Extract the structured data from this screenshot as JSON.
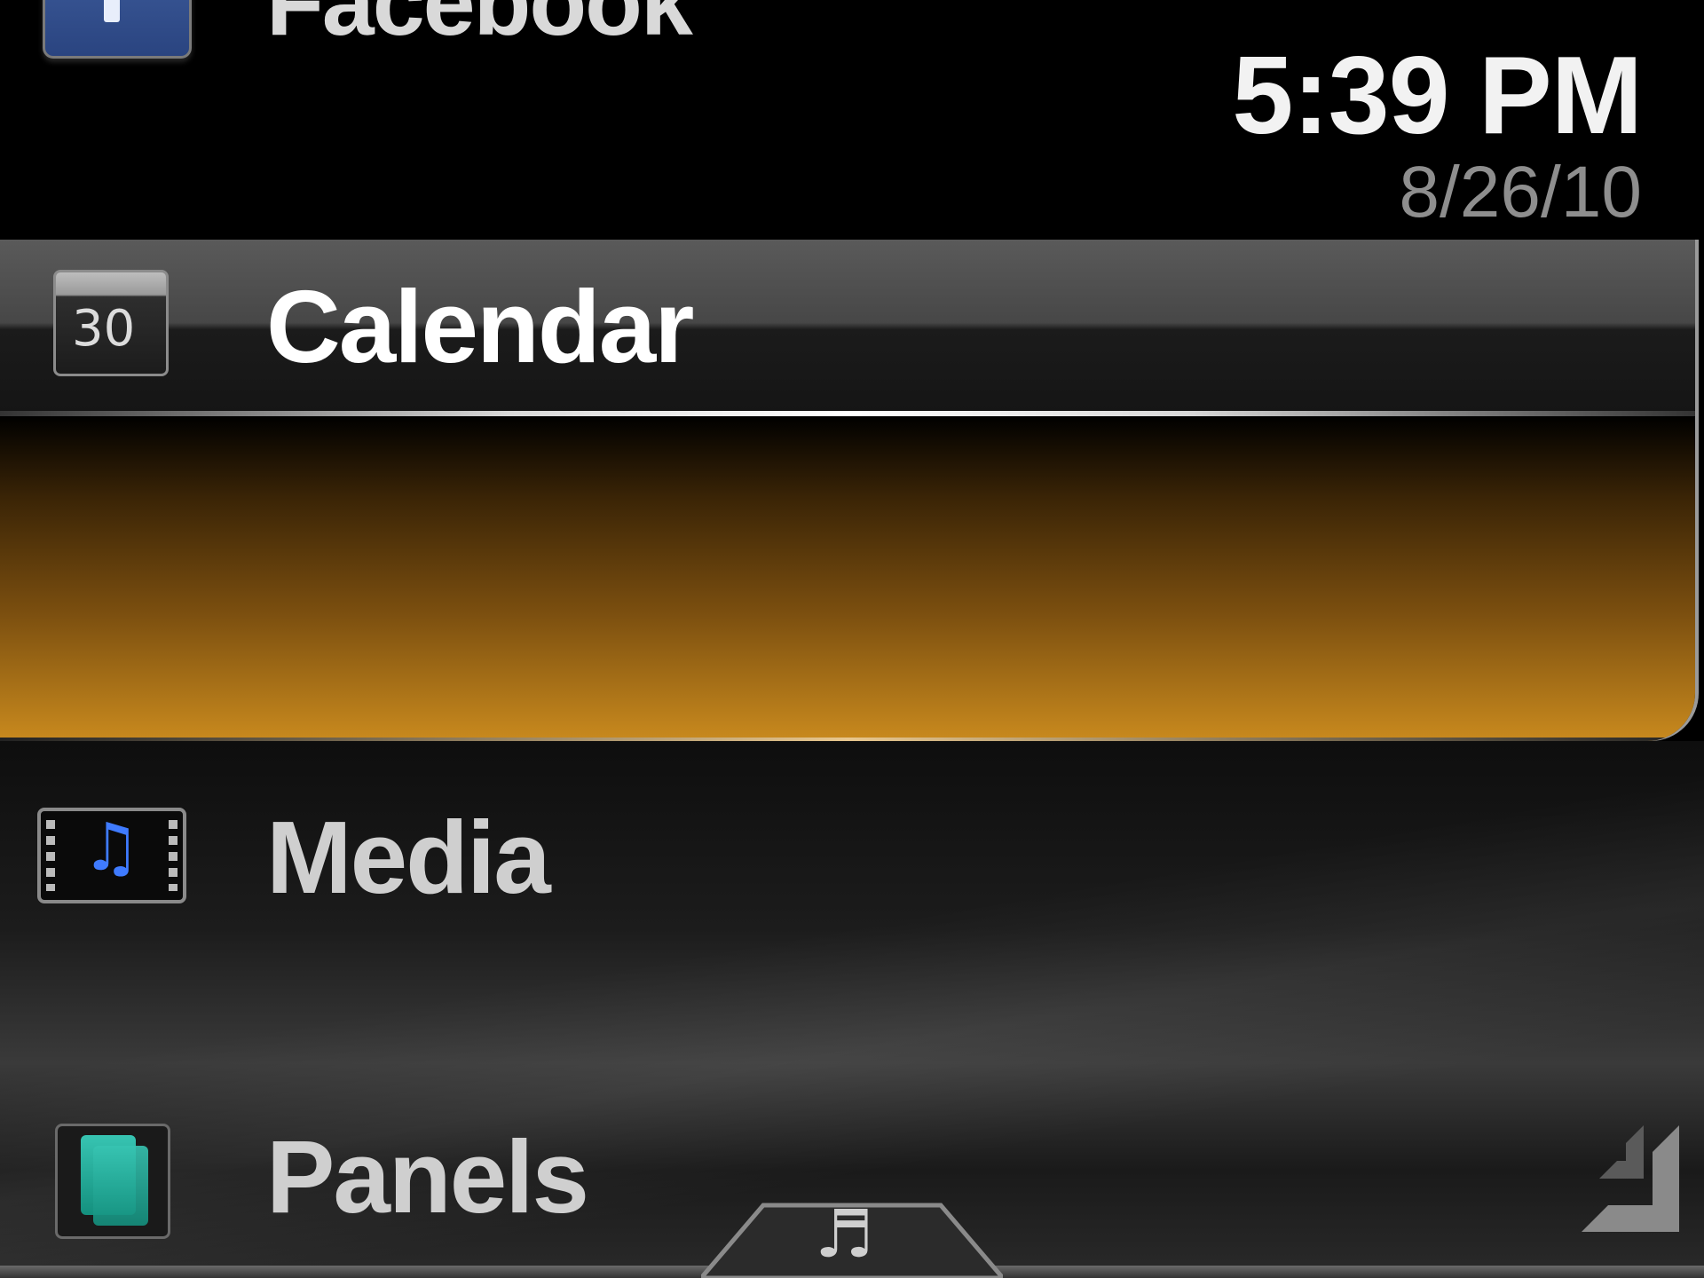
{
  "status": {
    "time": "5:39 PM",
    "date": "8/26/10"
  },
  "menu": {
    "items": [
      {
        "label": "Facebook",
        "icon": "facebook-icon",
        "selected": false
      },
      {
        "label": "Calendar",
        "icon": "calendar-icon",
        "icon_text": "30",
        "selected": true
      },
      {
        "label": "Media",
        "icon": "media-icon",
        "icon_glyph": "♫",
        "selected": false
      },
      {
        "label": "Panels",
        "icon": "panels-icon",
        "selected": false
      }
    ]
  },
  "bottom_bar": {
    "tab_icon": "music-note-icon",
    "tab_glyph": "♬"
  },
  "colors": {
    "highlight": "#c98a1e",
    "background": "#000000",
    "media_blue": "#3f7bff",
    "panels_teal": "#37c4b2"
  }
}
